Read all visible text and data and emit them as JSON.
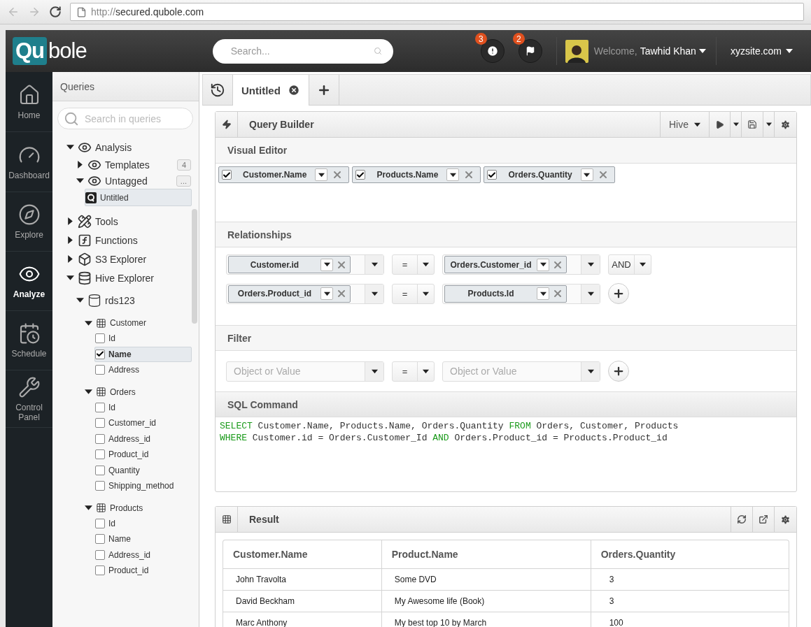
{
  "browser": {
    "url_scheme": "http://",
    "url_host": "secured.qubole.com"
  },
  "header": {
    "logo": {
      "mark": "Qu",
      "rest": "bole"
    },
    "search": {
      "placeholder": "Search..."
    },
    "notifications": [
      {
        "kind": "alert",
        "count": "3"
      },
      {
        "kind": "flag",
        "count": "2"
      }
    ],
    "user": {
      "greeting": "Welcome,",
      "name": "Tawhid Khan"
    },
    "site": "xyzsite.com"
  },
  "nav": {
    "items": [
      {
        "label": "Home",
        "selected": false
      },
      {
        "label": "Dashboard",
        "selected": false
      },
      {
        "label": "Explore",
        "selected": false
      },
      {
        "label": "Analyze",
        "selected": true
      },
      {
        "label": "Schedule",
        "selected": false
      },
      {
        "label": "Control Panel",
        "selected": false
      }
    ]
  },
  "queries": {
    "title": "Queries",
    "search": {
      "placeholder": "Search in queries"
    },
    "tree": [
      {
        "kind": "folder",
        "label": "Analysis",
        "expanded": true,
        "children": [
          {
            "kind": "folder",
            "label": "Templates",
            "expanded": false,
            "badge": "4"
          },
          {
            "kind": "folder",
            "label": "Untagged",
            "expanded": true,
            "badge": "...",
            "children": [
              {
                "kind": "query",
                "label": "Untitled",
                "selected": true
              }
            ]
          }
        ]
      },
      {
        "kind": "tools",
        "label": "Tools",
        "expanded": false
      },
      {
        "kind": "functions",
        "label": "Functions",
        "expanded": false
      },
      {
        "kind": "bucket",
        "label": "S3 Explorer",
        "expanded": false
      },
      {
        "kind": "warehouse",
        "label": "Hive Explorer",
        "expanded": true,
        "children": [
          {
            "kind": "database",
            "label": "rds123",
            "expanded": true,
            "children": [
              {
                "kind": "table",
                "label": "Customer",
                "expanded": true,
                "children": [
                  {
                    "kind": "column",
                    "label": "Id",
                    "checked": false,
                    "selected": false
                  },
                  {
                    "kind": "column",
                    "label": "Name",
                    "checked": true,
                    "selected": true
                  },
                  {
                    "kind": "column",
                    "label": "Address",
                    "checked": false,
                    "selected": false
                  }
                ]
              },
              {
                "kind": "table",
                "label": "Orders",
                "expanded": true,
                "children": [
                  {
                    "kind": "column",
                    "label": "Id",
                    "checked": false,
                    "selected": false
                  },
                  {
                    "kind": "column",
                    "label": "Customer_id",
                    "checked": false,
                    "selected": false
                  },
                  {
                    "kind": "column",
                    "label": "Address_id",
                    "checked": false,
                    "selected": false
                  },
                  {
                    "kind": "column",
                    "label": "Product_id",
                    "checked": false,
                    "selected": false
                  },
                  {
                    "kind": "column",
                    "label": "Quantity",
                    "checked": false,
                    "selected": false
                  },
                  {
                    "kind": "column",
                    "label": "Shipping_method",
                    "checked": false,
                    "selected": false
                  }
                ]
              },
              {
                "kind": "table",
                "label": "Products",
                "expanded": true,
                "children": [
                  {
                    "kind": "column",
                    "label": "Id",
                    "checked": false,
                    "selected": false
                  },
                  {
                    "kind": "column",
                    "label": "Name",
                    "checked": false,
                    "selected": false
                  },
                  {
                    "kind": "column",
                    "label": "Address_id",
                    "checked": false,
                    "selected": false
                  },
                  {
                    "kind": "column",
                    "label": "Product_id",
                    "checked": false,
                    "selected": false
                  }
                ]
              }
            ]
          }
        ]
      }
    ]
  },
  "tabs": [
    {
      "label": "Untitled",
      "selected": true
    }
  ],
  "query_builder": {
    "title": "Query Builder",
    "engine": "Hive",
    "visual_editor": {
      "title": "Visual Editor",
      "fields": [
        {
          "label": "Customer.Name",
          "checked": true
        },
        {
          "label": "Products.Name",
          "checked": true
        },
        {
          "label": "Orders.Quantity",
          "checked": true
        }
      ]
    },
    "relationships": {
      "title": "Relationships",
      "rows": [
        {
          "left": "Customer.id",
          "op": "=",
          "right": "Orders.Customer_id",
          "join": "AND",
          "add_button": false
        },
        {
          "left": "Orders.Product_id",
          "op": "=",
          "right": "Products.Id",
          "add_button": true
        }
      ]
    },
    "filter": {
      "title": "Filter",
      "left_placeholder": "Object or Value",
      "op": "=",
      "right_placeholder": "Object or Value"
    },
    "sql": {
      "title": "SQL Command",
      "lines": [
        [
          {
            "text": "SELECT",
            "keyword": true
          },
          {
            "text": " Customer.Name, Products.Name, Orders.Quantity ",
            "keyword": false
          },
          {
            "text": "FROM",
            "keyword": true
          },
          {
            "text": " Orders, Customer, Products",
            "keyword": false
          }
        ],
        [
          {
            "text": "WHERE",
            "keyword": true
          },
          {
            "text": " Customer.id = Orders.Customer_Id ",
            "keyword": false
          },
          {
            "text": "AND",
            "keyword": true
          },
          {
            "text": " Orders.Product_id = Products.Product_id",
            "keyword": false
          }
        ]
      ]
    }
  },
  "result": {
    "title": "Result",
    "columns": [
      "Customer.Name",
      "Product.Name",
      "Orders.Quantity"
    ],
    "rows": [
      [
        "John Travolta",
        "Some DVD",
        "3"
      ],
      [
        "David Beckham",
        "My Awesome life (Book)",
        "3"
      ],
      [
        "Marc Anthony",
        "My best top 10 by March",
        "100"
      ]
    ]
  }
}
